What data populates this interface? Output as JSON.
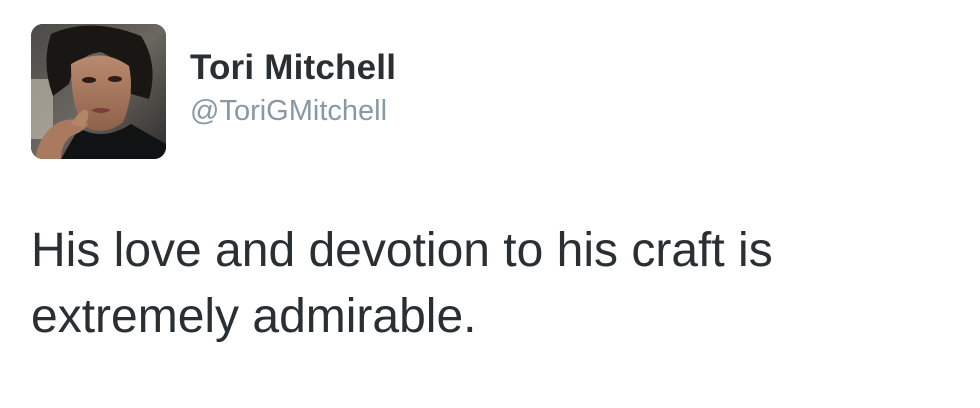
{
  "tweet": {
    "author": {
      "display_name": "Tori Mitchell",
      "handle": "@ToriGMitchell",
      "avatar_icon": "profile-photo"
    },
    "text": "His love and devotion to his craft is extremely admirable."
  },
  "colors": {
    "name_text": "#292f33",
    "handle_text": "#8899a6",
    "body_text": "#292f33",
    "background": "#ffffff"
  }
}
